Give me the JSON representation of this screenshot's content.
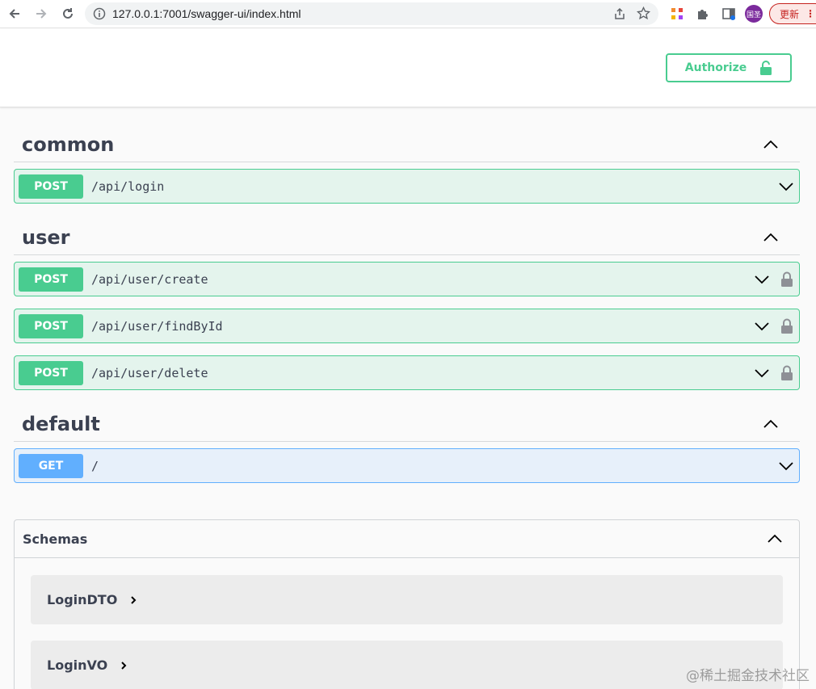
{
  "browser": {
    "url": "127.0.0.1:7001/swagger-ui/index.html",
    "profile_label": "国圣",
    "update_label": "更新",
    "menu_glyph": "⋮"
  },
  "auth": {
    "label": "Authorize"
  },
  "tags": [
    {
      "name": "common",
      "ops": [
        {
          "method": "POST",
          "path": "/api/login",
          "locked": false
        }
      ]
    },
    {
      "name": "user",
      "ops": [
        {
          "method": "POST",
          "path": "/api/user/create",
          "locked": true
        },
        {
          "method": "POST",
          "path": "/api/user/findById",
          "locked": true
        },
        {
          "method": "POST",
          "path": "/api/user/delete",
          "locked": true
        }
      ]
    },
    {
      "name": "default",
      "ops": [
        {
          "method": "GET",
          "path": "/",
          "locked": false
        }
      ]
    }
  ],
  "schemas": {
    "title": "Schemas",
    "models": [
      {
        "name": "LoginDTO"
      },
      {
        "name": "LoginVO"
      }
    ]
  },
  "watermark": "@稀土掘金技术社区",
  "colors": {
    "post": "#49cc90",
    "get": "#61affe",
    "text": "#3b4151"
  }
}
